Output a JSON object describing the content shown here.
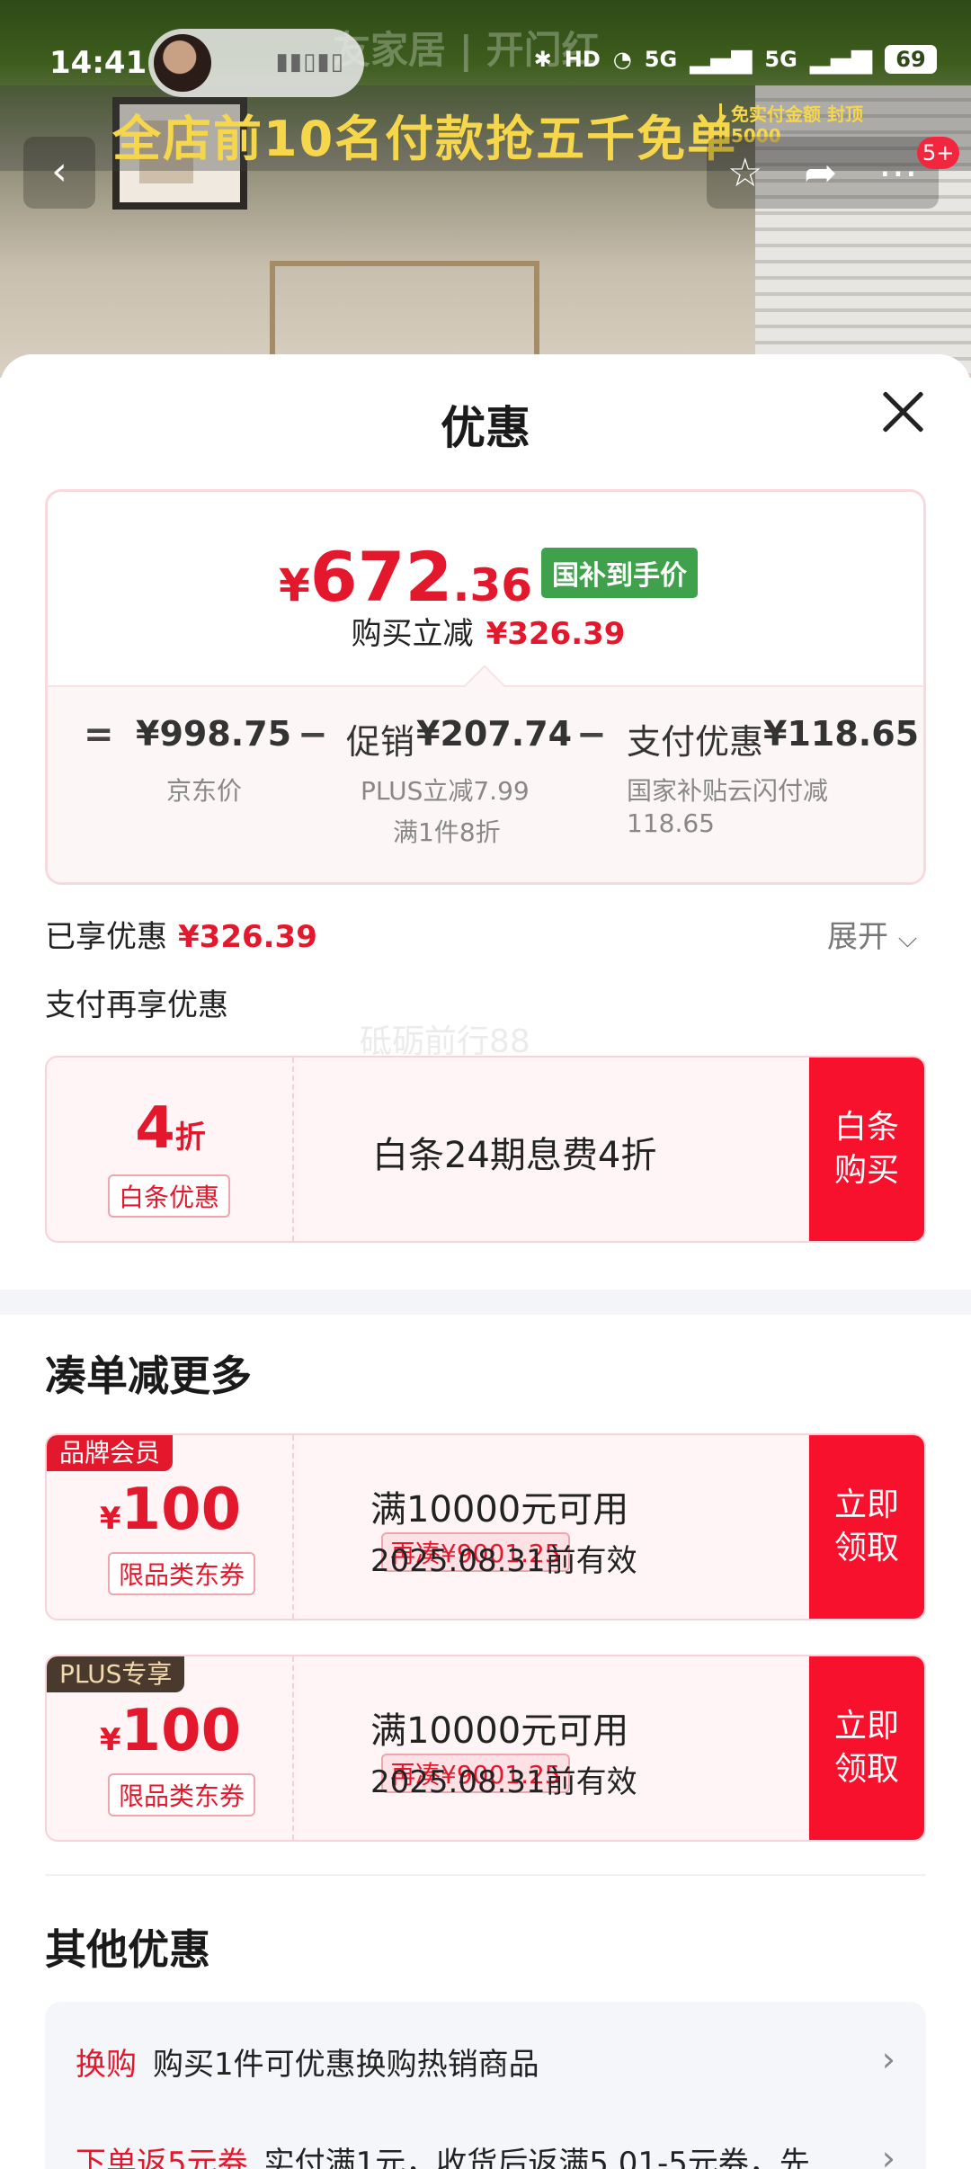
{
  "status_bar": {
    "time": "14:41",
    "hd": "HD",
    "signal1": "5G",
    "signal2": "5G",
    "battery": "69"
  },
  "background": {
    "store_title": "友家居 | 开门红",
    "promo_text": "全店前10名付款抢五千免单",
    "promo_side": "免实付金额 封顶5000"
  },
  "nav": {
    "cart_badge": "5+"
  },
  "sheet": {
    "title": "优惠",
    "price": {
      "yen": "¥",
      "integer": "672",
      "decimal": ".36",
      "tag": "国补到手价",
      "reduce_label": "购买立减",
      "reduce_value": "¥326.39"
    },
    "breakdown": {
      "eq": "=",
      "jd_price": "¥998.75",
      "jd_label": "京东价",
      "minus1": "−",
      "promo_label": "促销",
      "promo_value": "¥207.74",
      "promo_note1": "PLUS立减7.99",
      "promo_note2": "满1件8折",
      "minus2": "−",
      "pay_label": "支付优惠",
      "pay_value": "¥118.65",
      "pay_note1": "国家补贴云闪付减",
      "pay_note2": "118.65"
    },
    "enjoyed_label": "已享优惠",
    "enjoyed_value": "¥326.39",
    "expand_label": "展开",
    "pay_more_title": "支付再享优惠",
    "watermark": "砥砺前行88",
    "baitiao": {
      "amount": "4",
      "unit": "折",
      "sub": "白条优惠",
      "title": "白条24期息费4折",
      "button": "白条购买"
    },
    "combine_title": "凑单减更多",
    "coupons": [
      {
        "tag": "品牌会员",
        "yen": "¥",
        "amount": "100",
        "sub": "限品类东券",
        "title": "满10000元可用",
        "chip": "再凑¥9001.25",
        "date": "2025.08.31前有效",
        "button": "立即领取"
      },
      {
        "tag": "PLUS专享",
        "yen": "¥",
        "amount": "100",
        "sub": "限品类东券",
        "title": "满10000元可用",
        "chip": "再凑¥9001.25",
        "date": "2025.08.31前有效",
        "button": "立即领取"
      }
    ],
    "other_title": "其他优惠",
    "other": [
      {
        "label": "换购",
        "text": "购买1件可优惠换购热销商品"
      },
      {
        "label": "下单返5元券",
        "text": "实付满1元，收货后返满5.01-5元券，先"
      }
    ]
  },
  "colors": {
    "accent_red": "#f8112d",
    "price_red": "#e4182c",
    "green_tag": "#3fa14c"
  }
}
